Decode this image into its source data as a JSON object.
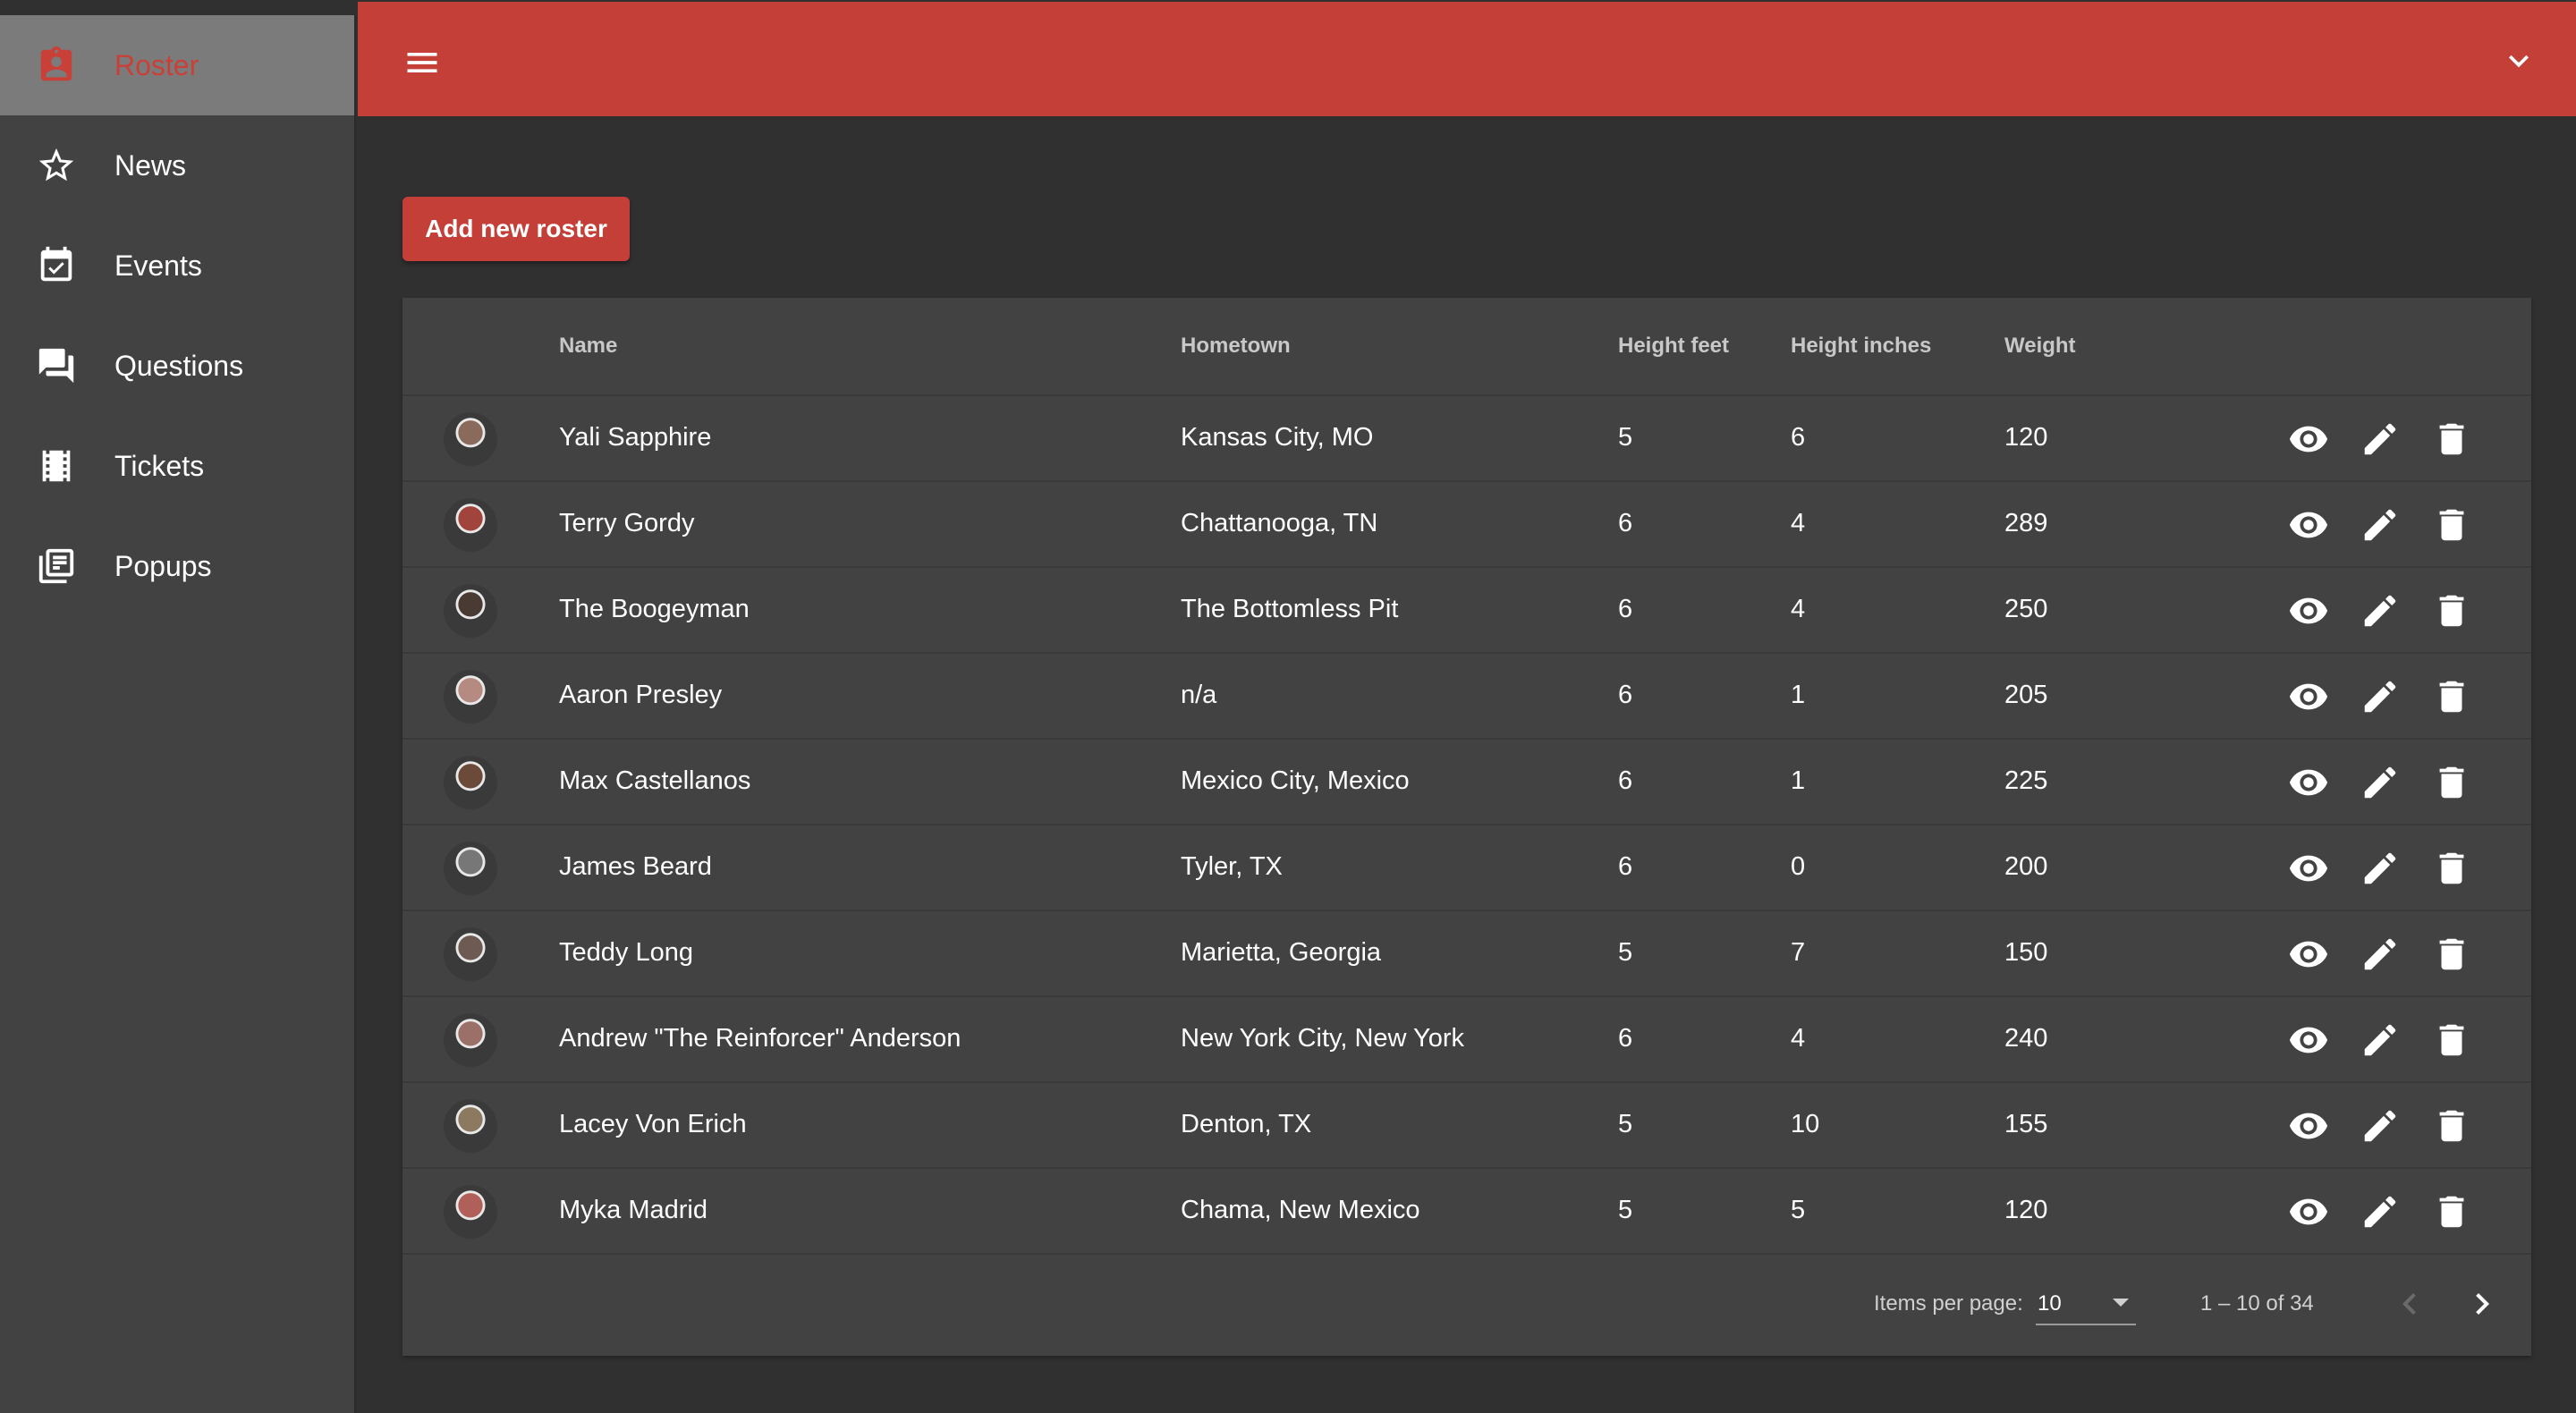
{
  "sidebar": {
    "items": [
      {
        "label": "Roster",
        "icon": "contact-badge-icon"
      },
      {
        "label": "News",
        "icon": "star-outline-icon"
      },
      {
        "label": "Events",
        "icon": "event-available-icon"
      },
      {
        "label": "Questions",
        "icon": "forum-icon"
      },
      {
        "label": "Tickets",
        "icon": "film-strip-icon"
      },
      {
        "label": "Popups",
        "icon": "library-books-icon"
      }
    ],
    "active": "Roster"
  },
  "header": {
    "menu_icon": "hamburger-menu-icon",
    "account_icon": "chevron-down-icon"
  },
  "actions": {
    "add_label": "Add new roster"
  },
  "table": {
    "columns": {
      "name": "Name",
      "hometown": "Hometown",
      "height_feet": "Height feet",
      "height_inches": "Height inches",
      "weight": "Weight"
    },
    "rows": [
      {
        "name": "Yali Sapphire",
        "hometown": "Kansas City, MO",
        "height_feet": "5",
        "height_inches": "6",
        "weight": "120"
      },
      {
        "name": "Terry Gordy",
        "hometown": "Chattanooga, TN",
        "height_feet": "6",
        "height_inches": "4",
        "weight": "289"
      },
      {
        "name": "The Boogeyman",
        "hometown": "The Bottomless Pit",
        "height_feet": "6",
        "height_inches": "4",
        "weight": "250"
      },
      {
        "name": "Aaron Presley",
        "hometown": "n/a",
        "height_feet": "6",
        "height_inches": "1",
        "weight": "205"
      },
      {
        "name": "Max Castellanos",
        "hometown": "Mexico City, Mexico",
        "height_feet": "6",
        "height_inches": "1",
        "weight": "225"
      },
      {
        "name": "James Beard",
        "hometown": "Tyler, TX",
        "height_feet": "6",
        "height_inches": "0",
        "weight": "200"
      },
      {
        "name": "Teddy Long",
        "hometown": "Marietta, Georgia",
        "height_feet": "5",
        "height_inches": "7",
        "weight": "150"
      },
      {
        "name": "Andrew \"The Reinforcer\" Anderson",
        "hometown": "New York City, New York",
        "height_feet": "6",
        "height_inches": "4",
        "weight": "240"
      },
      {
        "name": "Lacey Von Erich",
        "hometown": "Denton, TX",
        "height_feet": "5",
        "height_inches": "10",
        "weight": "155"
      },
      {
        "name": "Myka Madrid",
        "hometown": "Chama, New Mexico",
        "height_feet": "5",
        "height_inches": "5",
        "weight": "120"
      }
    ],
    "row_actions": [
      "view-eye-icon",
      "edit-pencil-icon",
      "delete-trash-icon"
    ]
  },
  "paginator": {
    "items_per_page_label": "Items per page:",
    "items_per_page_value": "10",
    "range_label": "1 – 10 of 34"
  },
  "colors": {
    "accent": "#c43f38",
    "sidebar_bg": "#424242",
    "page_bg": "#303030",
    "card_bg": "#424242",
    "active_item_bg": "#7b7b7b"
  }
}
